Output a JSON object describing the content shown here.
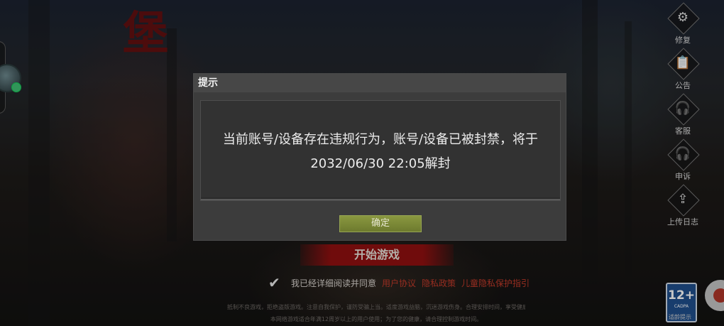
{
  "dialog": {
    "title": "提示",
    "message": "当前账号/设备存在违规行为，账号/设备已被封禁，将于2032/06/30 22:05解封",
    "confirm_label": "确定"
  },
  "side_menu": [
    {
      "icon": "gear-repair-icon",
      "glyph": "⚙",
      "label": "修复"
    },
    {
      "icon": "clipboard-icon",
      "glyph": "📋",
      "label": "公告"
    },
    {
      "icon": "headset-icon",
      "glyph": "🎧",
      "label": "客服"
    },
    {
      "icon": "headset-appeal-icon",
      "glyph": "🎧",
      "label": "申诉"
    },
    {
      "icon": "upload-icon",
      "glyph": "⇪",
      "label": "上传日志"
    }
  ],
  "start_button": "开始游戏",
  "agreement": {
    "prefix": "我已经详细阅读并同意",
    "links": [
      "用户协议",
      "隐私政策",
      "儿童隐私保护指引"
    ]
  },
  "footer_lines": [
    "抵制不良游戏，拒绝盗版游戏。注意自我保护，谨防受骗上当。适度游戏益脑，沉迷游戏伤身。合理安排时间，享受健康生活。",
    "本网络游戏适合年满12周岁以上的用户使用；为了您的健康，请合理控制游戏时间。"
  ],
  "age_rating": {
    "number": "12+",
    "org": "CADPA",
    "caption": "适龄提示"
  }
}
